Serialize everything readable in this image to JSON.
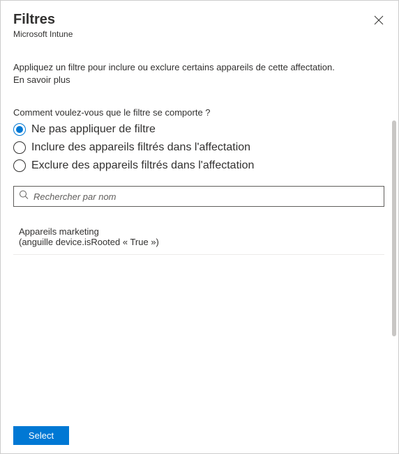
{
  "header": {
    "title": "Filtres",
    "subtitle": "Microsoft Intune"
  },
  "description": "Appliquez un filtre pour inclure ou exclure certains appareils de cette affectation.",
  "learn_more": "En savoir plus",
  "question": "Comment voulez-vous que le filtre se comporte ?",
  "radios": {
    "opt0": "Ne pas appliquer de filtre",
    "opt1": "Inclure des appareils filtrés dans l'affectation",
    "opt2": "Exclure des appareils filtrés dans l'affectation",
    "selected_index": 0
  },
  "search": {
    "placeholder": "Rechercher par nom",
    "value": ""
  },
  "filter_item": {
    "name": "Appareils marketing",
    "rule": "(anguille device.isRooted « True »)"
  },
  "footer": {
    "select_label": "Select"
  }
}
